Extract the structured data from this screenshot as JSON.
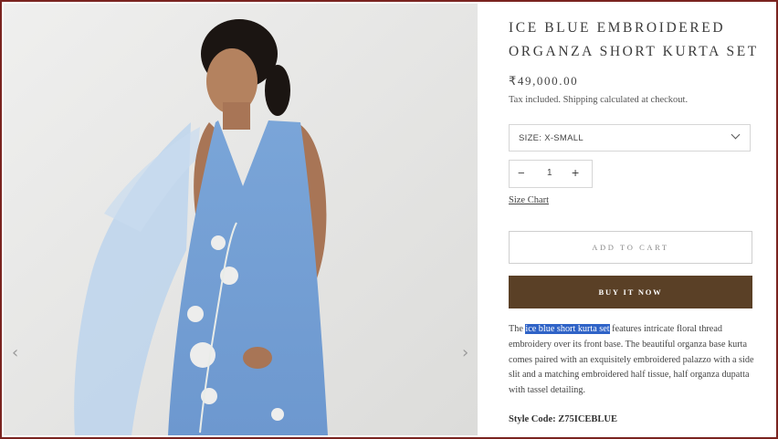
{
  "product": {
    "title_line1": "ICE BLUE EMBROIDERED",
    "title_line2": "ORGANZA SHORT KURTA SET",
    "price": "₹49,000.00",
    "tax_note": "Tax included. Shipping calculated at checkout.",
    "size_label": "SIZE: X-SMALL",
    "quantity": "1",
    "size_chart_link": "Size Chart",
    "add_to_cart": "ADD TO CART",
    "buy_now": "BUY IT NOW",
    "description_prefix": "The ",
    "description_highlight": "ice blue short kurta set",
    "description_rest": " features intricate floral thread embroidery over its front base. The beautiful organza base kurta comes paired with an exquisitely embroidered palazzo with a side slit and a matching embroidered half tissue, half organza dupatta with tassel detailing.",
    "style_code_label": "Style Code: Z75ICEBLUE"
  },
  "gallery": {
    "prev_icon": "chevron-left-icon",
    "next_icon": "chevron-right-icon",
    "prev_glyph": "‹",
    "next_glyph": "›",
    "image_description_colors": [
      "#e9e8e6",
      "#7fa6d6",
      "#a8c8e8"
    ]
  },
  "controls": {
    "minus_glyph": "−",
    "plus_glyph": "+"
  },
  "colors": {
    "frame_border": "#7a2420",
    "buy_now_bg": "#5a4026",
    "highlight": "#2f63c7"
  }
}
